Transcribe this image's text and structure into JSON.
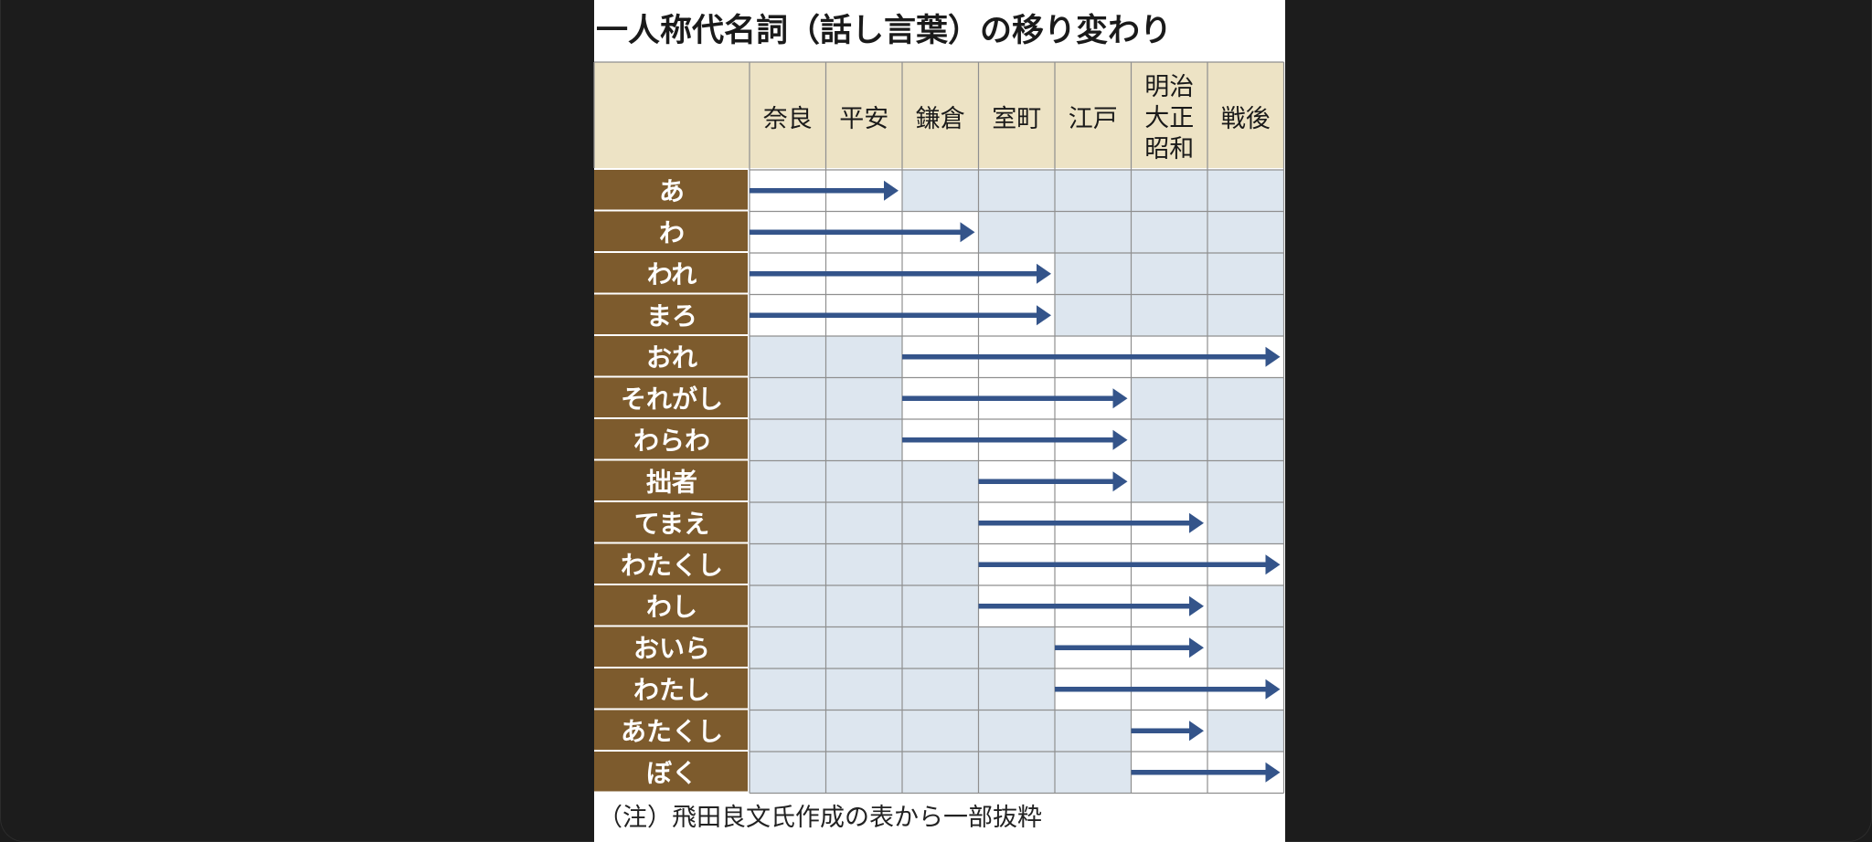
{
  "chart_data": {
    "type": "table",
    "title": "一人称代名詞（話し言葉）の移り変わり",
    "periods": [
      {
        "lines": [
          "奈良"
        ]
      },
      {
        "lines": [
          "平安"
        ]
      },
      {
        "lines": [
          "鎌倉"
        ]
      },
      {
        "lines": [
          "室町"
        ]
      },
      {
        "lines": [
          "江戸"
        ]
      },
      {
        "lines": [
          "明治",
          "大正",
          "昭和"
        ]
      },
      {
        "lines": [
          "戦後"
        ]
      }
    ],
    "rows": [
      {
        "label": "あ",
        "start": 0,
        "end": 2
      },
      {
        "label": "わ",
        "start": 0,
        "end": 3
      },
      {
        "label": "われ",
        "start": 0,
        "end": 4
      },
      {
        "label": "まろ",
        "start": 0,
        "end": 4
      },
      {
        "label": "おれ",
        "start": 2,
        "end": 7
      },
      {
        "label": "それがし",
        "start": 2,
        "end": 5
      },
      {
        "label": "わらわ",
        "start": 2,
        "end": 5
      },
      {
        "label": "拙者",
        "start": 3,
        "end": 5
      },
      {
        "label": "てまえ",
        "start": 3,
        "end": 6
      },
      {
        "label": "わたくし",
        "start": 3,
        "end": 7
      },
      {
        "label": "わし",
        "start": 3,
        "end": 6
      },
      {
        "label": "おいら",
        "start": 4,
        "end": 6
      },
      {
        "label": "わたし",
        "start": 4,
        "end": 7
      },
      {
        "label": "あたくし",
        "start": 5,
        "end": 6
      },
      {
        "label": "ぼく",
        "start": 5,
        "end": 7
      }
    ],
    "note": "（注）飛田良文氏作成の表から一部抜粋"
  },
  "colors": {
    "header_bg": "#ede3c5",
    "label_bg": "#7d5b2d",
    "cell_bg": "#dde6ef",
    "grid": "#8f8f8f",
    "arrow": "#34548a"
  }
}
